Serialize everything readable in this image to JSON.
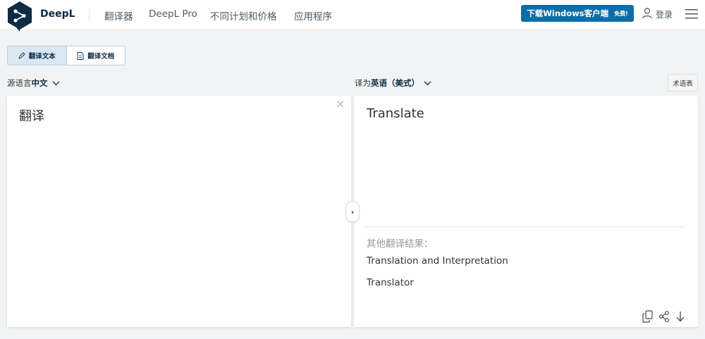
{
  "header": {
    "brand": "DeepL",
    "nav": [
      "翻译器",
      "DeepL Pro",
      "不同计划和价格",
      "应用程序"
    ],
    "download_label": "下载Windows客户端",
    "download_badge": "免费!",
    "login_label": "登录"
  },
  "mode": {
    "text_tab": "翻译文本",
    "doc_tab": "翻译文档"
  },
  "source": {
    "prefix": "源语言",
    "language": "中文",
    "text": "翻译"
  },
  "target": {
    "prefix": "译为",
    "language": "英语（美式）",
    "text": "Translate",
    "glossary_label": "术语表",
    "alternatives_title": "其他翻译结果：",
    "alternatives": [
      "Translation and Interpretation",
      "Translator"
    ]
  },
  "colors": {
    "brand_navy": "#0f2b46",
    "accent_blue": "#0e6da8",
    "background": "#f2f3f4"
  }
}
